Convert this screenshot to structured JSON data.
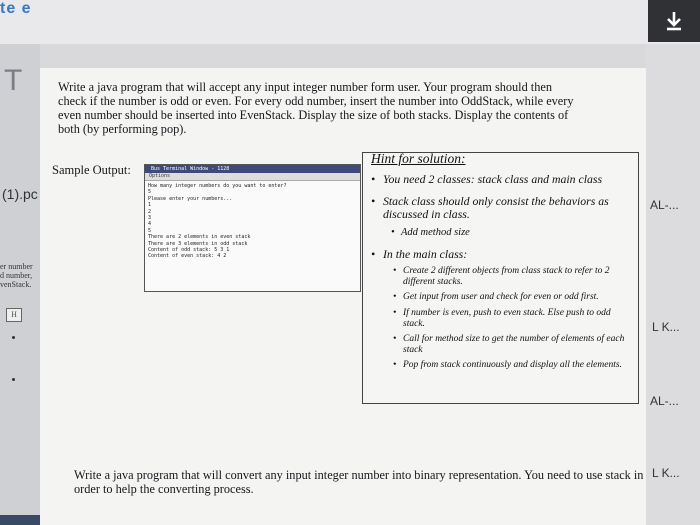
{
  "topbar": {
    "logo_fragment": "te e",
    "download_icon": "download-arrow-icon"
  },
  "left_panel": {
    "logo_letter": "T",
    "file_tab": "(1).pc",
    "snippet_lines": [
      "er number",
      "d number,",
      "venStack."
    ],
    "editor_icon": "H"
  },
  "question1": {
    "text": "Write a java program that will accept any input integer number form user. Your program should then check if the number is odd or even. For every odd number, insert the number into OddStack, while every even number should be inserted into EvenStack. Display the size of both stacks. Display the contents of both (by performing pop)."
  },
  "sample_label": "Sample Output:",
  "console": {
    "title": "Bus Terminal Window - 1128",
    "menu": "Options",
    "lines": [
      "How many integer numbers do you want to enter?",
      "5",
      "Please enter your numbers...",
      "1",
      "2",
      "3",
      "4",
      "5",
      "There are 2 elements in even stack",
      "There are 3 elements in odd stack",
      "Content of odd stack: 5 3 1",
      "Content of even stack: 4 2"
    ]
  },
  "hint": {
    "title": "Hint for solution:",
    "b1": "You need 2 classes: stack class and main class",
    "b2": "Stack class should only consist the behaviors as discussed in class.",
    "b2_sub": "Add method size",
    "b3": "In the main class:",
    "subs": [
      "Create 2 different objects from class stack to refer to 2 different stacks.",
      "Get input from user and check for even or odd first.",
      "If number is even, push to even stack. Else push to odd stack.",
      "Call for method size to get the number of elements of each stack",
      "Pop from stack continuously and display all the elements."
    ]
  },
  "right_labels": [
    "AL-...",
    "L K...",
    "AL-...",
    "L K..."
  ],
  "question2": {
    "text": "Write a java program that will convert any input integer number into binary representation. You need to use stack in order to help the converting process."
  }
}
